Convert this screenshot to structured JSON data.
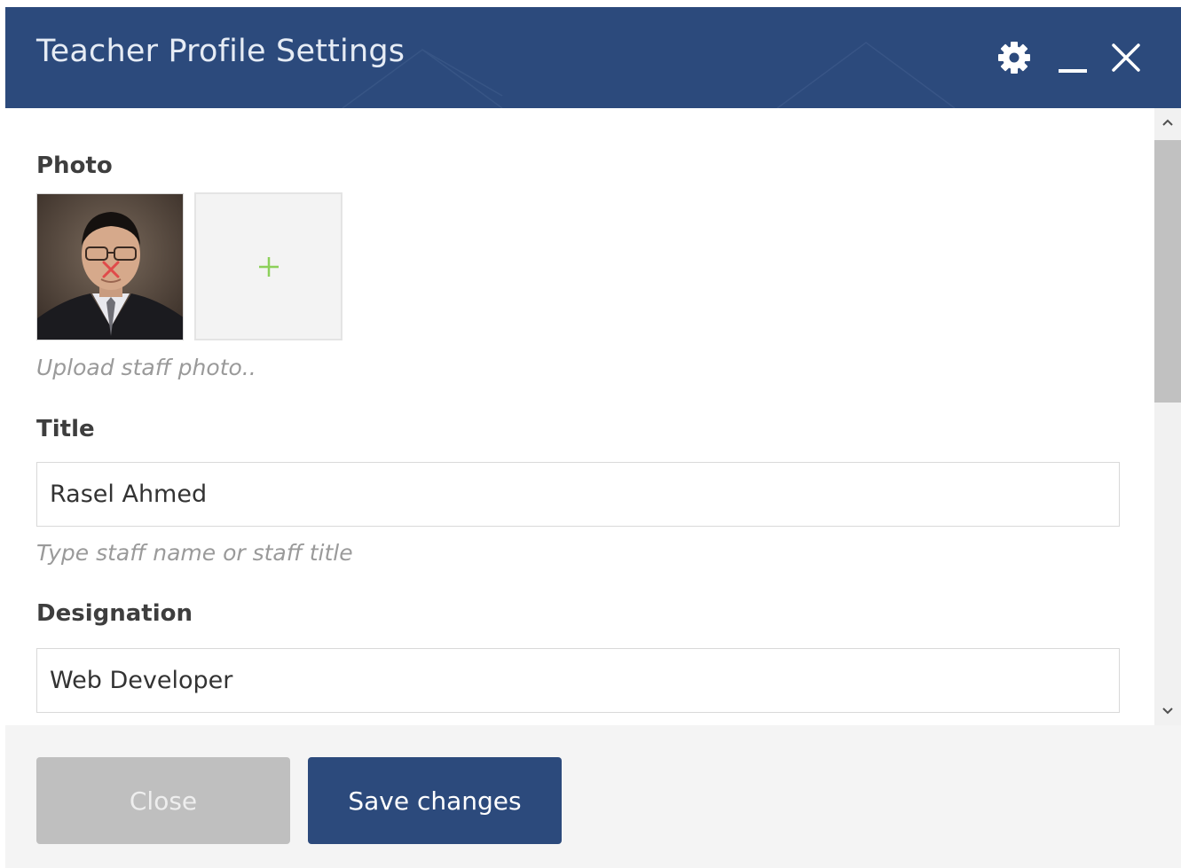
{
  "dialog": {
    "title": "Teacher Profile Settings",
    "header_icons": [
      "gear-icon",
      "minimize-icon",
      "close-icon"
    ],
    "colors": {
      "header": "#2c4a7c",
      "primary_button": "#2c4a7c",
      "disabled_button": "#bfbfbf",
      "add_plus": "#8cd05a",
      "remove_x": "#e04a4a"
    }
  },
  "form": {
    "photo": {
      "label": "Photo",
      "hint": "Upload staff photo..",
      "add_icon": "plus-icon",
      "remove_icon": "remove-x-icon"
    },
    "title": {
      "label": "Title",
      "value": "Rasel Ahmed",
      "hint": "Type staff name or staff title"
    },
    "designation": {
      "label": "Designation",
      "value": "Web Developer"
    }
  },
  "footer": {
    "close_label": "Close",
    "save_label": "Save changes"
  },
  "scrollbar": {
    "up_icon": "chevron-up-icon",
    "down_icon": "chevron-down-icon"
  }
}
